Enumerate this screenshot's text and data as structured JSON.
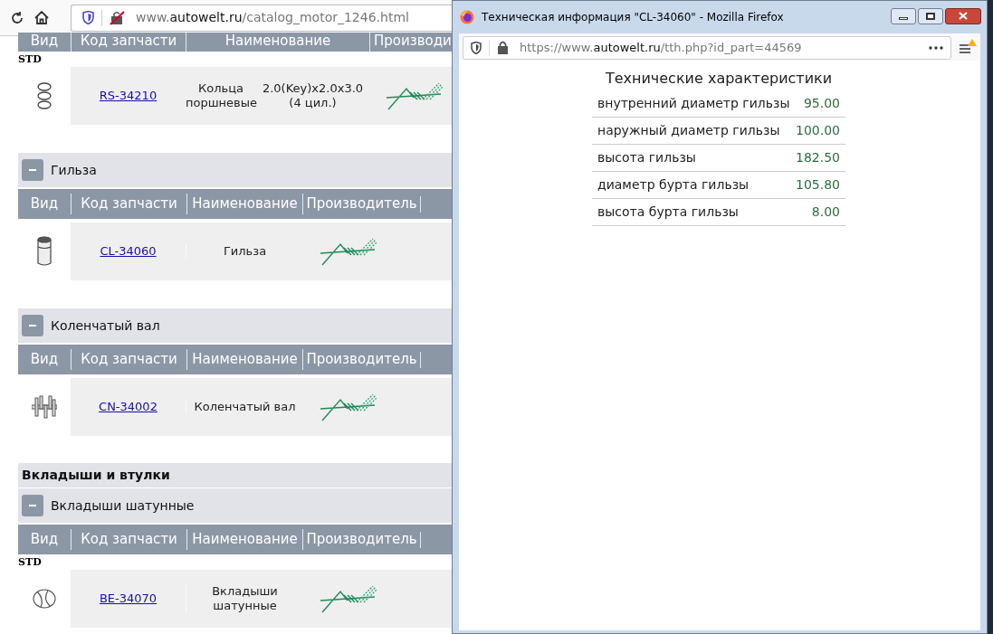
{
  "main_browser": {
    "url_prefix": "www.",
    "url_domain": "autowelt.ru",
    "url_path": "/catalog_motor_1246.html"
  },
  "catalog": [
    {
      "kind": "table",
      "columns": [
        "Вид",
        "Код запчасти",
        "Наименование",
        "Производи"
      ],
      "variant": "STD",
      "rows": [
        {
          "kind": "rings",
          "code": "RS-34210",
          "name": "Кольца поршневые",
          "spec": "2.0(Key)x2.0x3.0 (4 цил.)"
        }
      ]
    },
    {
      "kind": "group",
      "title": "Гильза",
      "expanded": true,
      "columns": [
        "Вид",
        "Код запчасти",
        "Наименование",
        "Производитель"
      ],
      "rows": [
        {
          "kind": "sleeve",
          "code": "CL-34060",
          "name": "Гильза"
        }
      ]
    },
    {
      "kind": "group",
      "title": "Коленчатый вал",
      "expanded": true,
      "columns": [
        "Вид",
        "Код запчасти",
        "Наименование",
        "Производитель"
      ],
      "rows": [
        {
          "kind": "crankshaft",
          "code": "CN-34002",
          "name": "Коленчатый вал"
        }
      ]
    },
    {
      "kind": "category",
      "title": "Вкладыши и втулки"
    },
    {
      "kind": "group",
      "title": "Вкладыши шатунные",
      "expanded": true,
      "columns": [
        "Вид",
        "Код запчасти",
        "Наименование",
        "Производитель"
      ],
      "variant": "STD",
      "rows": [
        {
          "kind": "bearing",
          "code": "BE-34070",
          "name": "Вкладыши шатунные"
        }
      ]
    }
  ],
  "popup": {
    "title": "Техническая информация \"CL-34060\" - Mozilla Firefox",
    "url_prefix": "https://www.",
    "url_domain": "autowelt.ru",
    "url_path": "/tth.php?id_part=44569",
    "heading": "Технические характеристики",
    "specs": [
      {
        "label": "внутренний диаметр гильзы",
        "value": "95.00"
      },
      {
        "label": "наружный диаметр гильзы",
        "value": "100.00"
      },
      {
        "label": "высота гильзы",
        "value": "182.50"
      },
      {
        "label": "диаметр бурта гильзы",
        "value": "105.80"
      },
      {
        "label": "высота бурта гильзы",
        "value": "8.00"
      }
    ]
  }
}
